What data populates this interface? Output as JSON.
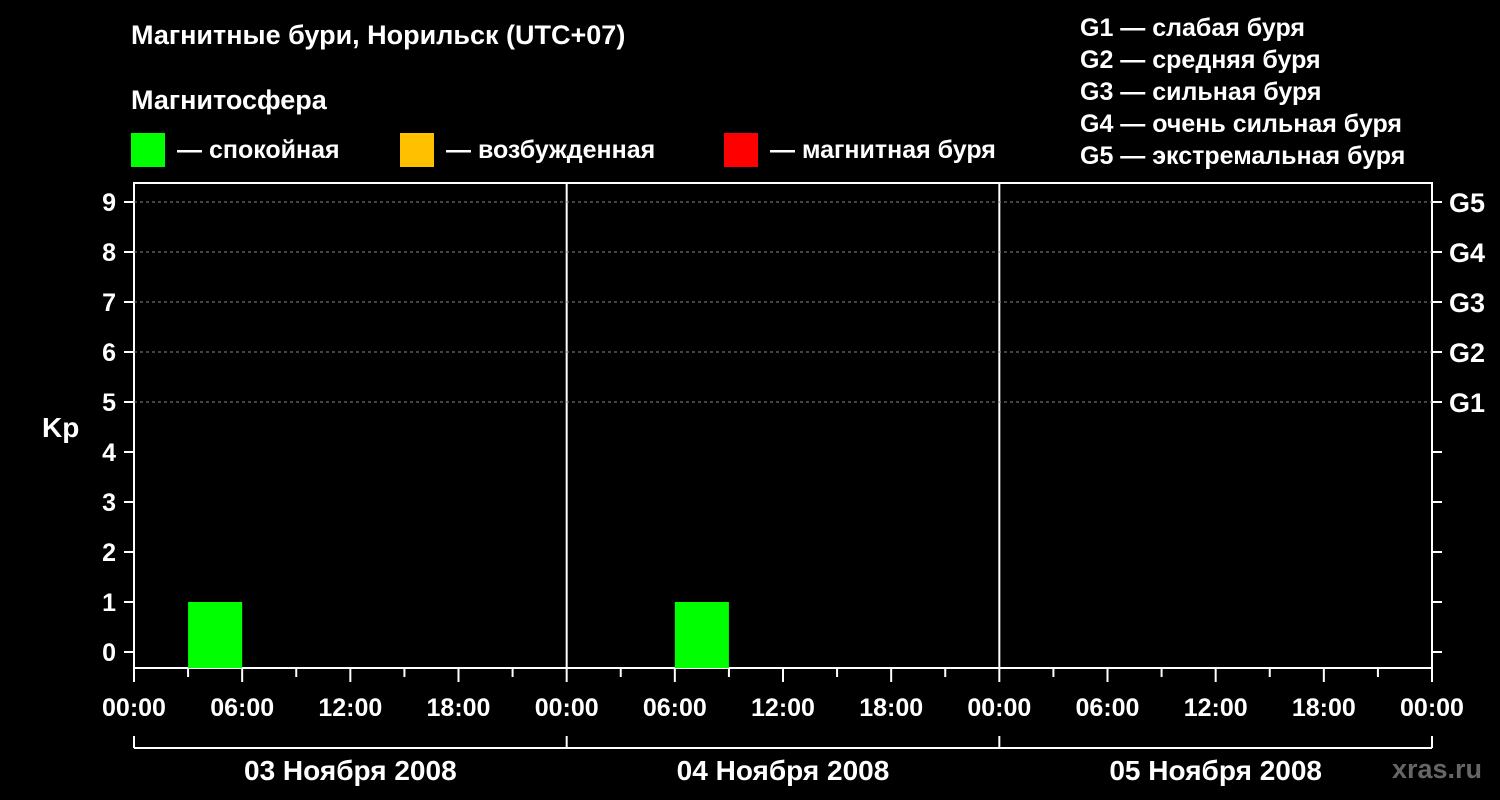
{
  "title": "Магнитные бури, Норильск (UTC+07)",
  "subtitle": "Магнитосфера",
  "legend": [
    {
      "label": "— спокойная",
      "color": "#00ff00"
    },
    {
      "label": "— возбужденная",
      "color": "#ffc000"
    },
    {
      "label": "— магнитная буря",
      "color": "#ff0000"
    }
  ],
  "g_levels": [
    "G1 — слабая буря",
    "G2 — средняя буря",
    "G3 — сильная буря",
    "G4 — очень сильная буря",
    "G5 — экстремальная буря"
  ],
  "watermark": "xras.ru",
  "chart_data": {
    "type": "bar",
    "ylabel": "Kp",
    "ylim": [
      0,
      9
    ],
    "y_ticks": [
      "0",
      "1",
      "2",
      "3",
      "4",
      "5",
      "6",
      "7",
      "8",
      "9"
    ],
    "right_axis_ticks": [
      {
        "y": 5,
        "label": "G1"
      },
      {
        "y": 6,
        "label": "G2"
      },
      {
        "y": 7,
        "label": "G3"
      },
      {
        "y": 8,
        "label": "G4"
      },
      {
        "y": 9,
        "label": "G5"
      }
    ],
    "grid": "dashed horizontal at Kp 5–9",
    "x_tick_labels": [
      "00:00",
      "06:00",
      "12:00",
      "18:00",
      "00:00",
      "06:00",
      "12:00",
      "18:00",
      "00:00",
      "06:00",
      "12:00",
      "18:00",
      "00:00"
    ],
    "days": [
      "03 Ноября 2008",
      "04 Ноября 2008",
      "05 Ноября 2008"
    ],
    "bars": [
      {
        "day": 0,
        "start_hour": 3,
        "end_hour": 6,
        "value": 1,
        "color": "#00ff00"
      },
      {
        "day": 1,
        "start_hour": 6,
        "end_hour": 9,
        "value": 1,
        "color": "#00ff00"
      }
    ]
  }
}
